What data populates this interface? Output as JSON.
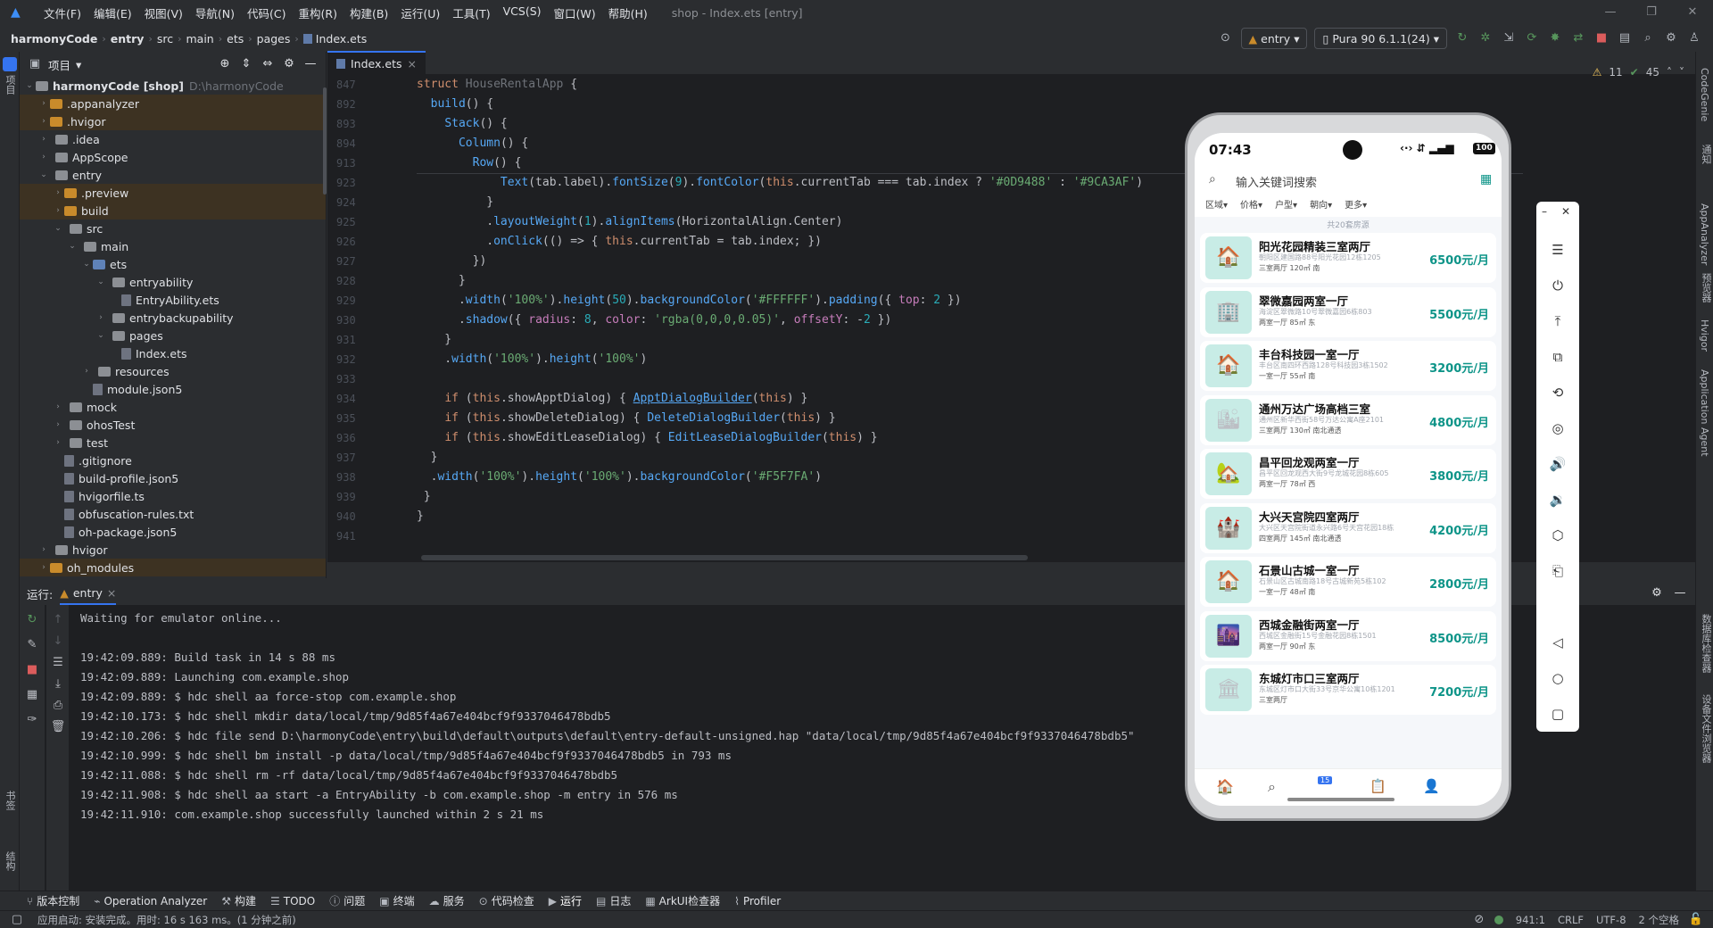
{
  "menu": {
    "items": [
      "文件(F)",
      "编辑(E)",
      "视图(V)",
      "导航(N)",
      "代码(C)",
      "重构(R)",
      "构建(B)",
      "运行(U)",
      "工具(T)",
      "VCS(S)",
      "窗口(W)",
      "帮助(H)"
    ],
    "window_title": "shop - Index.ets [entry]"
  },
  "breadcrumb": [
    "harmonyCode",
    "entry",
    "src",
    "main",
    "ets",
    "pages",
    "Index.ets"
  ],
  "toolbar": {
    "module": "entry",
    "device": "Pura 90 6.1.1(24)"
  },
  "project": {
    "header": "项目",
    "root_name": "harmonyCode [shop]",
    "root_path": "D:\\harmonyCode",
    "tree": [
      {
        "label": ".appanalyzer",
        "depth": 1,
        "type": "folder",
        "color": "orange",
        "arrow": "›",
        "hl": true
      },
      {
        "label": ".hvigor",
        "depth": 1,
        "type": "folder",
        "color": "orange",
        "arrow": "›",
        "hl": true
      },
      {
        "label": ".idea",
        "depth": 1,
        "type": "folder",
        "color": "grey",
        "arrow": "›",
        "hl": false
      },
      {
        "label": "AppScope",
        "depth": 1,
        "type": "folder",
        "color": "grey",
        "arrow": "›",
        "hl": false
      },
      {
        "label": "entry",
        "depth": 1,
        "type": "folder",
        "color": "grey",
        "arrow": "⌄",
        "hl": false
      },
      {
        "label": ".preview",
        "depth": 2,
        "type": "folder",
        "color": "orange",
        "arrow": "›",
        "hl": true
      },
      {
        "label": "build",
        "depth": 2,
        "type": "folder",
        "color": "orange",
        "arrow": "›",
        "hl": true
      },
      {
        "label": "src",
        "depth": 2,
        "type": "folder",
        "color": "grey",
        "arrow": "⌄",
        "hl": false
      },
      {
        "label": "main",
        "depth": 3,
        "type": "folder",
        "color": "grey",
        "arrow": "⌄",
        "hl": false
      },
      {
        "label": "ets",
        "depth": 4,
        "type": "folder",
        "color": "blue",
        "arrow": "⌄",
        "hl": false
      },
      {
        "label": "entryability",
        "depth": 5,
        "type": "folder",
        "color": "grey",
        "arrow": "⌄",
        "hl": false
      },
      {
        "label": "EntryAbility.ets",
        "depth": 6,
        "type": "file",
        "color": "",
        "arrow": "",
        "hl": false
      },
      {
        "label": "entrybackupability",
        "depth": 5,
        "type": "folder",
        "color": "grey",
        "arrow": "›",
        "hl": false
      },
      {
        "label": "pages",
        "depth": 5,
        "type": "folder",
        "color": "grey",
        "arrow": "⌄",
        "hl": false
      },
      {
        "label": "Index.ets",
        "depth": 6,
        "type": "file",
        "color": "",
        "arrow": "",
        "hl": false
      },
      {
        "label": "resources",
        "depth": 4,
        "type": "folder",
        "color": "grey",
        "arrow": "›",
        "hl": false
      },
      {
        "label": "module.json5",
        "depth": 4,
        "type": "file",
        "color": "",
        "arrow": "",
        "hl": false
      },
      {
        "label": "mock",
        "depth": 2,
        "type": "folder",
        "color": "grey",
        "arrow": "›",
        "hl": false
      },
      {
        "label": "ohosTest",
        "depth": 2,
        "type": "folder",
        "color": "grey",
        "arrow": "›",
        "hl": false
      },
      {
        "label": "test",
        "depth": 2,
        "type": "folder",
        "color": "grey",
        "arrow": "›",
        "hl": false
      },
      {
        "label": ".gitignore",
        "depth": 2,
        "type": "file",
        "color": "",
        "arrow": "",
        "hl": false
      },
      {
        "label": "build-profile.json5",
        "depth": 2,
        "type": "file",
        "color": "",
        "arrow": "",
        "hl": false
      },
      {
        "label": "hvigorfile.ts",
        "depth": 2,
        "type": "file",
        "color": "",
        "arrow": "",
        "hl": false
      },
      {
        "label": "obfuscation-rules.txt",
        "depth": 2,
        "type": "file",
        "color": "",
        "arrow": "",
        "hl": false
      },
      {
        "label": "oh-package.json5",
        "depth": 2,
        "type": "file",
        "color": "",
        "arrow": "",
        "hl": false
      },
      {
        "label": "hvigor",
        "depth": 1,
        "type": "folder",
        "color": "grey",
        "arrow": "›",
        "hl": false
      },
      {
        "label": "oh_modules",
        "depth": 1,
        "type": "folder",
        "color": "orange",
        "arrow": "›",
        "hl": true
      }
    ]
  },
  "editor": {
    "tab": "Index.ets",
    "inspections": {
      "warnings": "11",
      "ok": "45"
    },
    "sticky_lines": [
      {
        "n": "847",
        "html": "<span class='kw'>struct</span> <span class='dim'>HouseRentalApp</span> {"
      },
      {
        "n": "892",
        "html": "  <span class='fn'>build</span>() {"
      },
      {
        "n": "893",
        "html": "    <span class='fn'>Stack</span>() {"
      },
      {
        "n": "894",
        "html": "      <span class='fn'>Column</span>() {"
      },
      {
        "n": "913",
        "html": "        <span class='fn'>Row</span>() {"
      }
    ],
    "lines": [
      {
        "n": "923",
        "html": "            <span class='fn'>Text</span>(tab.label).<span class='fn'>fontSize</span>(<span class='num'>9</span>).<span class='fn'>fontColor</span>(<span class='kw'>this</span>.currentTab === tab.index ? <span class='str'>'#0D9488'</span> : <span class='str'>'#9CA3AF'</span>)"
      },
      {
        "n": "924",
        "html": "          }"
      },
      {
        "n": "925",
        "html": "          .<span class='fn'>layoutWeight</span>(<span class='num'>1</span>).<span class='fn'>alignItems</span>(HorizontalAlign.Center)"
      },
      {
        "n": "926",
        "html": "          .<span class='fn'>onClick</span>(() => { <span class='kw'>this</span>.currentTab = tab.index; })"
      },
      {
        "n": "927",
        "html": "        })"
      },
      {
        "n": "928",
        "html": "      }"
      },
      {
        "n": "929",
        "html": "      .<span class='fn'>width</span>(<span class='str'>'100%'</span>).<span class='fn'>height</span>(<span class='num'>50</span>).<span class='fn'>backgroundColor</span>(<span class='str'>'#FFFFFF'</span>).<span class='fn'>padding</span>({ <span class='prop'>top</span>: <span class='num'>2</span> })"
      },
      {
        "n": "930",
        "html": "      .<span class='fn'>shadow</span>({ <span class='prop'>radius</span>: <span class='num'>8</span>, <span class='prop'>color</span>: <span class='str'>'rgba(0,0,0,0.05)'</span>, <span class='prop'>offsetY</span>: -<span class='num'>2</span> })"
      },
      {
        "n": "931",
        "html": "    }"
      },
      {
        "n": "932",
        "html": "    .<span class='fn'>width</span>(<span class='str'>'100%'</span>).<span class='fn'>height</span>(<span class='str'>'100%'</span>)"
      },
      {
        "n": "933",
        "html": ""
      },
      {
        "n": "934",
        "html": "    <span class='kw'>if</span> (<span class='kw'>this</span>.showApptDialog) { <span class='und'>ApptDialogBuilder</span>(<span class='kw'>this</span>) }"
      },
      {
        "n": "935",
        "html": "    <span class='kw'>if</span> (<span class='kw'>this</span>.showDeleteDialog) { <span class='fn'>DeleteDialogBuilder</span>(<span class='kw'>this</span>) }"
      },
      {
        "n": "936",
        "html": "    <span class='kw'>if</span> (<span class='kw'>this</span>.showEditLeaseDialog) { <span class='fn'>EditLeaseDialogBuilder</span>(<span class='kw'>this</span>) }"
      },
      {
        "n": "937",
        "html": "  }"
      },
      {
        "n": "938",
        "html": "  .<span class='fn'>width</span>(<span class='str'>'100%'</span>).<span class='fn'>height</span>(<span class='str'>'100%'</span>).<span class='fn'>backgroundColor</span>(<span class='str'>'#F5F7FA'</span>)"
      },
      {
        "n": "939",
        "html": " }"
      },
      {
        "n": "940",
        "html": "}"
      },
      {
        "n": "941",
        "html": ""
      }
    ]
  },
  "run": {
    "label": "运行:",
    "config": "entry",
    "console": [
      "Waiting for emulator online...",
      "",
      "19:42:09.889: Build task in 14 s 88 ms",
      "19:42:09.889: Launching com.example.shop",
      "19:42:09.889: $ hdc shell aa force-stop com.example.shop",
      "19:42:10.173: $ hdc shell mkdir data/local/tmp/9d85f4a67e404bcf9f9337046478bdb5",
      "19:42:10.206: $ hdc file send D:\\harmonyCode\\entry\\build\\default\\outputs\\default\\entry-default-unsigned.hap \"data/local/tmp/9d85f4a67e404bcf9f9337046478bdb5\"",
      "19:42:10.999: $ hdc shell bm install -p data/local/tmp/9d85f4a67e404bcf9f9337046478bdb5 in 793 ms",
      "19:42:11.088: $ hdc shell rm -rf data/local/tmp/9d85f4a67e404bcf9f9337046478bdb5",
      "19:42:11.908: $ hdc shell aa start -a EntryAbility -b com.example.shop -m entry in 576 ms",
      "19:42:11.910: com.example.shop successfully launched within 2 s 21 ms"
    ]
  },
  "bottom_tabs": [
    "版本控制",
    "Operation Analyzer",
    "构建",
    "TODO",
    "问题",
    "终端",
    "服务",
    "代码检查",
    "运行",
    "日志",
    "ArkUI检查器",
    "Profiler"
  ],
  "status": {
    "message": "应用启动: 安装完成。用时: 16 s 163 ms。(1 分钟之前)",
    "position": "941:1",
    "line_sep": "CRLF",
    "encoding": "UTF-8",
    "indent": "2 个空格"
  },
  "left_strip": [
    "项目",
    "书签",
    "结构"
  ],
  "right_strip": [
    "CodeGenie",
    "通知",
    "AppAnalyzer",
    "预览器",
    "Hvigor",
    "Application Agent",
    "数据库检查器",
    "设备文件浏览器"
  ],
  "phone": {
    "time": "07:43",
    "battery": "100",
    "search_placeholder": "输入关键词搜索",
    "filters": [
      "区域▾",
      "价格▾",
      "户型▾",
      "朝向▾",
      "更多▾"
    ],
    "count": "共20套房源",
    "accent": "#0d9488",
    "listings": [
      {
        "title": "阳光花园精装三室两厅",
        "addr": "朝阳区建国路88号阳光花园12栋1205",
        "meta": "三室两厅   120㎡   南",
        "price": "6500元/月",
        "icon": "house"
      },
      {
        "title": "翠微嘉园两室一厅",
        "addr": "海淀区翠微路10号翠微嘉园6栋803",
        "meta": "两室一厅   85㎡   东",
        "price": "5500元/月",
        "icon": "building"
      },
      {
        "title": "丰台科技园一室一厅",
        "addr": "丰台区南四环西路128号科技园3栋1502",
        "meta": "一室一厅   55㎡   南",
        "price": "3200元/月",
        "icon": "house"
      },
      {
        "title": "通州万达广场高档三室",
        "addr": "通州区新华西街58号万达公寓A座2101",
        "meta": "三室两厅   130㎡   南北通透",
        "price": "4800元/月",
        "icon": "city"
      },
      {
        "title": "昌平回龙观两室一厅",
        "addr": "昌平区回龙观西大街9号龙城花园8栋605",
        "meta": "两室一厅   78㎡   西",
        "price": "3800元/月",
        "icon": "tree"
      },
      {
        "title": "大兴天宫院四室两厅",
        "addr": "大兴区天宫院街道永兴路6号天宫花园18栋",
        "meta": "四室两厅   145㎡   南北通透",
        "price": "4200元/月",
        "icon": "castle"
      },
      {
        "title": "石景山古城一室一厅",
        "addr": "石景山区古城南路18号古城新苑5栋102",
        "meta": "一室一厅   48㎡   南",
        "price": "2800元/月",
        "icon": "house"
      },
      {
        "title": "西城金融街两室一厅",
        "addr": "西城区金融街15号金融花园8栋1501",
        "meta": "两室一厅   90㎡   东",
        "price": "8500元/月",
        "icon": "night"
      },
      {
        "title": "东城灯市口三室两厅",
        "addr": "东城区灯市口大街33号京华公寓10栋1201",
        "meta": "三室两厅",
        "price": "7200元/月",
        "icon": "temple"
      }
    ],
    "tab_badge": "15"
  }
}
